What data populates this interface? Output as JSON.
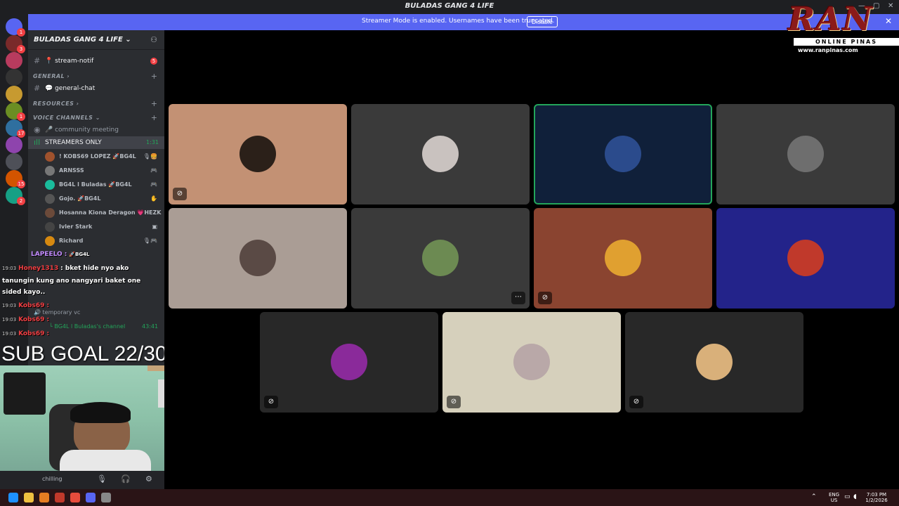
{
  "window": {
    "title": "BULADAS GANG 4 LIFE"
  },
  "banner": {
    "message": "Streamer Mode is enabled. Usernames have been truncated.",
    "disable_label": "Disable",
    "close_glyph": "✕"
  },
  "servers": [
    {
      "color": "#5865f2",
      "badge": "1",
      "icon": "discord-icon"
    },
    {
      "color": "#7a2a2a",
      "badge": "3"
    },
    {
      "color": "#b83b5e",
      "badge": ""
    },
    {
      "color": "#333333",
      "badge": ""
    },
    {
      "color": "#c79a30",
      "badge": ""
    },
    {
      "color": "#6b8e23",
      "badge": "1"
    },
    {
      "color": "#2f6f9f",
      "badge": "17"
    },
    {
      "color": "#8e44ad",
      "badge": ""
    },
    {
      "color": "#4e5058",
      "badge": ""
    },
    {
      "color": "#d35400",
      "badge": "15"
    },
    {
      "color": "#16a085",
      "badge": "2"
    }
  ],
  "guild": {
    "name": "BULADAS GANG 4 LIFE ⌄"
  },
  "channels": {
    "stream_notif": {
      "name": "📍 stream-notif",
      "badge": "5"
    },
    "cat_general": "GENERAL ›",
    "general_chat": "💬 general-chat",
    "cat_resources": "RESOURCES ›",
    "cat_voice": "VOICE CHANNELS ⌄",
    "community": "🎤 community meeting",
    "streamers": {
      "name": "STREAMERS ONLY",
      "time": "1:31"
    }
  },
  "voice_users": [
    {
      "name": "! KOBS69 LOPEZ 🚀BG4L",
      "color": "#a0522d",
      "status": "🎙🍔"
    },
    {
      "name": "ARNSSS",
      "color": "#777777",
      "status": "🎮"
    },
    {
      "name": "BG4L l Buladas 🚀BG4L",
      "color": "#1abc9c",
      "status": "🎮"
    },
    {
      "name": "Gojo. 🚀BG4L",
      "color": "#555555",
      "status": "✋"
    },
    {
      "name": "Hosanna Kiona Deragon 💗HEZK",
      "color": "#6b4a3a",
      "status": ""
    },
    {
      "name": "Ivler Stark",
      "color": "#444444",
      "status": "▣"
    },
    {
      "name": "Richard",
      "color": "#d68910",
      "status": "🎙🎮"
    }
  ],
  "chat": {
    "line1_user": "LAPEELO :",
    "line1_tag": "🚀BG4L",
    "line2_time": "19:03",
    "line2_user": "Honey1313",
    "line2_text": ": bket hide nyo ako",
    "wrap_text": "tanungin kung ano nangyari baket one sided kayo..",
    "kobs_lines": [
      {
        "time": "19:03",
        "user": "Kobs69 :"
      },
      {
        "time": "19:03",
        "user": "Kobs69 :"
      },
      {
        "time": "19:03",
        "user": "Kobs69 :"
      }
    ],
    "temp_vc": "🔊 temporary vc",
    "buladas_channel": "└ BG4L l Buladas's channel",
    "buladas_time": "43:41"
  },
  "sub_goal": "SUB GOAL 22/300",
  "user_panel": {
    "status": "chilling",
    "mic_icon": "🎙",
    "headset_icon": "🎧",
    "settings_icon": "⚙"
  },
  "tiles": [
    {
      "bg": "#c39174",
      "avatar": "#2b2019",
      "muted": true,
      "speaking": false
    },
    {
      "bg": "#3a3a3a",
      "avatar": "#c9c2bf",
      "muted": false,
      "speaking": false
    },
    {
      "bg": "#10203a",
      "avatar": "#2b4b8c",
      "muted": false,
      "speaking": true
    },
    {
      "bg": "#3a3a3a",
      "avatar": "#6e6e6e",
      "muted": false,
      "speaking": false
    },
    {
      "bg": "#aa9d95",
      "avatar": "#5a4a45",
      "muted": false,
      "speaking": false
    },
    {
      "bg": "#3a3a3a",
      "avatar": "#6c8a52",
      "muted": false,
      "speaking": false,
      "more": true
    },
    {
      "bg": "#8a4430",
      "avatar": "#e0a030",
      "muted": true,
      "speaking": false
    },
    {
      "bg": "#23238a",
      "avatar": "#c0392b",
      "muted": false,
      "speaking": false
    },
    {
      "bg": "#282828",
      "avatar": "#8a2a9a",
      "muted": true,
      "speaking": false
    },
    {
      "bg": "#d6d0bc",
      "avatar": "#b9a8a8",
      "muted": true,
      "speaking": false
    },
    {
      "bg": "#282828",
      "avatar": "#d9b07a",
      "muted": true,
      "speaking": false
    }
  ],
  "logo": {
    "big": "RAN",
    "sub": "ONLINE PINAS",
    "url": "www.ranpinas.com"
  },
  "taskbar": {
    "lang_top": "ENG",
    "lang_bottom": "US",
    "time": "7:03 PM",
    "date": "1/2/2026",
    "apps": [
      "#1e90ff",
      "#f0c040",
      "#e67e22",
      "#c0392b",
      "#e74c3c",
      "#5865f2",
      "#888888"
    ]
  }
}
